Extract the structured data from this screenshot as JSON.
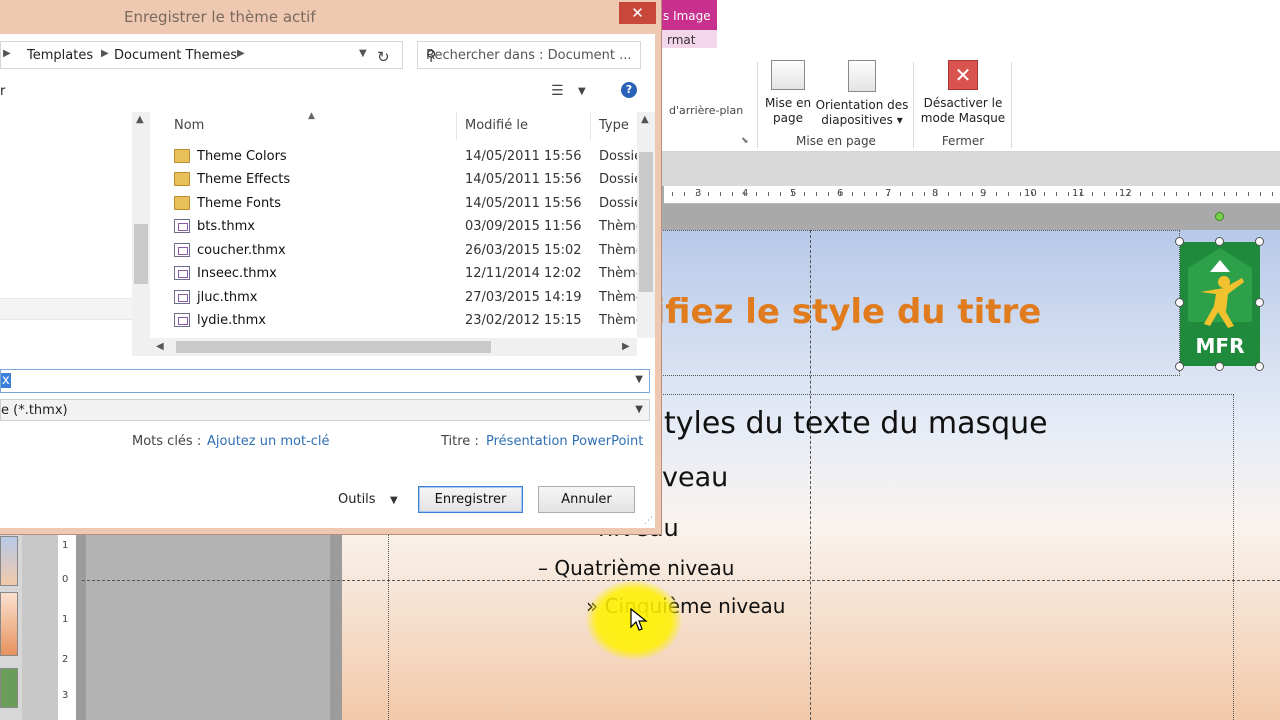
{
  "dialog": {
    "title": "Enregistrer le thème actif",
    "close_glyph": "✕",
    "breadcrumb": [
      "Templates",
      "Document Themes"
    ],
    "search_placeholder": "Rechercher dans : Document ...",
    "org_fragment": "r",
    "columns": {
      "name": "Nom",
      "date": "Modifié le",
      "type": "Type"
    },
    "files": [
      {
        "name": "Theme Colors",
        "date": "14/05/2011 15:56",
        "type": "Dossie",
        "kind": "folder"
      },
      {
        "name": "Theme Effects",
        "date": "14/05/2011 15:56",
        "type": "Dossie",
        "kind": "folder"
      },
      {
        "name": "Theme Fonts",
        "date": "14/05/2011 15:56",
        "type": "Dossie",
        "kind": "folder"
      },
      {
        "name": "bts.thmx",
        "date": "03/09/2015 11:56",
        "type": "Thème",
        "kind": "file"
      },
      {
        "name": "coucher.thmx",
        "date": "26/03/2015 15:02",
        "type": "Thème",
        "kind": "file"
      },
      {
        "name": "Inseec.thmx",
        "date": "12/11/2014 12:02",
        "type": "Thème",
        "kind": "file"
      },
      {
        "name": "jluc.thmx",
        "date": "27/03/2015 14:19",
        "type": "Thème",
        "kind": "file"
      },
      {
        "name": "lydie.thmx",
        "date": "23/02/2012 15:15",
        "type": "Thème",
        "kind": "file"
      }
    ],
    "filename_value": "x",
    "filetype_value": "e (*.thmx)",
    "keywords_label": "Mots clés :",
    "keywords_value": "Ajoutez un mot-clé",
    "title_label": "Titre :",
    "title_value": "Présentation PowerPoint",
    "tools_label": "Outils",
    "save_label": "Enregistrer",
    "cancel_label": "Annuler"
  },
  "ribbon": {
    "tab_format_image": "s Image",
    "tab_format": "rmat",
    "background_fragment": "d'arrière-plan",
    "buttons": {
      "page_setup": [
        "Mise en",
        "page"
      ],
      "orientation": [
        "Orientation des",
        "diapositives ▾"
      ],
      "close_master": [
        "Désactiver le",
        "mode Masque"
      ]
    },
    "groups": {
      "page_setup": "Mise en page",
      "close": "Fermer"
    }
  },
  "ruler": {
    "h_numbers": [
      "3",
      "4",
      "5",
      "6",
      "7",
      "8",
      "9",
      "10",
      "11",
      "12"
    ],
    "v_numbers": [
      "1",
      "0",
      "1",
      "2",
      "3"
    ]
  },
  "slide": {
    "title": "lifiez le style du titre",
    "body": [
      {
        "text": "tyles du texte du masque",
        "size": 30
      },
      {
        "text": "veau",
        "size": 27
      },
      {
        "text": "niveau",
        "size": 24
      },
      {
        "text": "– Quatrième niveau",
        "size": 20
      },
      {
        "text": "» Cinquième niveau",
        "size": 20
      }
    ],
    "logo_text": "MFR"
  },
  "colors": {
    "accent_title": "#e07b1e",
    "dialog_frame": "#eec8b0",
    "tab_contextual": "#c9308d",
    "logo_green": "#1f8a3b",
    "link_blue": "#2f6fb5"
  }
}
